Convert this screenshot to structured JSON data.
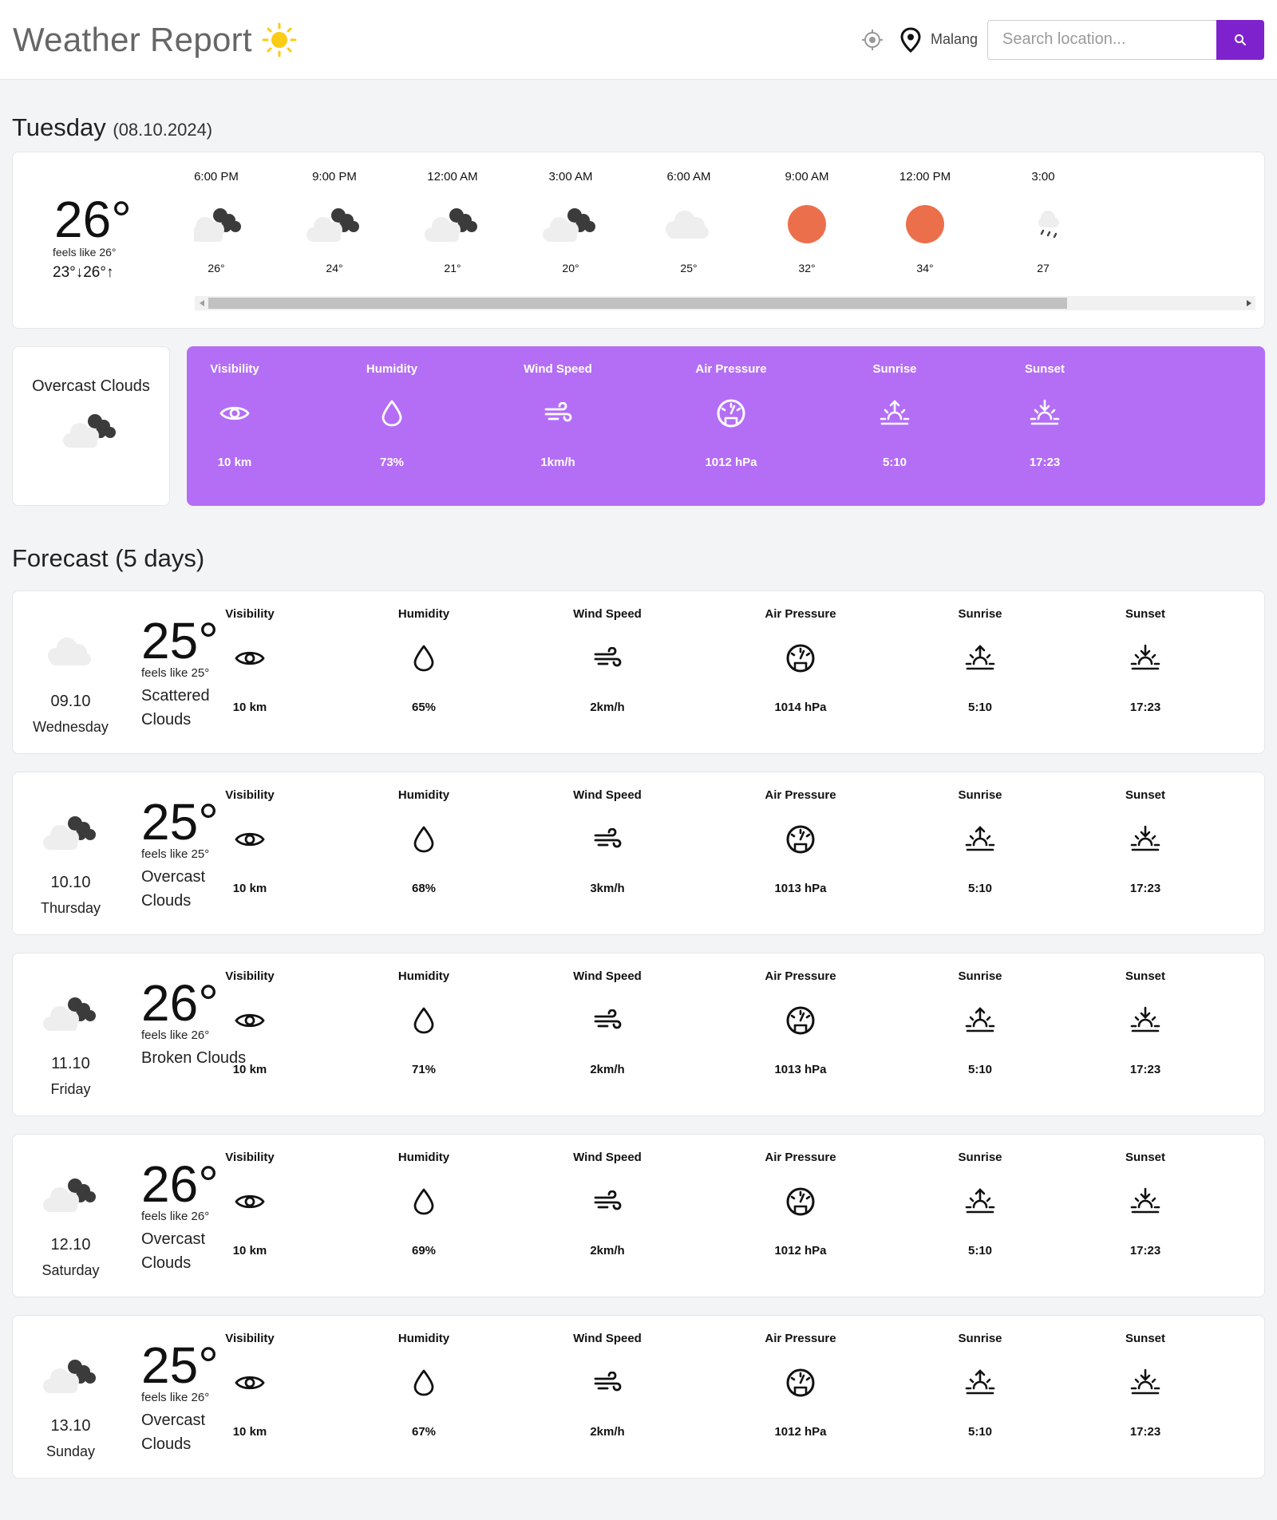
{
  "header": {
    "title": "Weather Report",
    "city": "Malang",
    "search_placeholder": "Search location..."
  },
  "today": {
    "day": "Tuesday",
    "date": "(08.10.2024)",
    "temp": "26°",
    "feels_like": "feels like 26°",
    "range": "23°↓26°↑",
    "hourly": [
      {
        "time": "6:00 PM",
        "icon": "overcast-cloud-icon",
        "temp": "26°"
      },
      {
        "time": "9:00 PM",
        "icon": "overcast-cloud-icon",
        "temp": "24°"
      },
      {
        "time": "12:00 AM",
        "icon": "overcast-cloud-icon",
        "temp": "21°"
      },
      {
        "time": "3:00 AM",
        "icon": "overcast-cloud-icon",
        "temp": "20°"
      },
      {
        "time": "6:00 AM",
        "icon": "cloud-icon",
        "temp": "25°"
      },
      {
        "time": "9:00 AM",
        "icon": "sun-icon",
        "temp": "32°"
      },
      {
        "time": "12:00 PM",
        "icon": "sun-icon",
        "temp": "34°"
      },
      {
        "time": "3:00",
        "icon": "rain-icon",
        "temp": "27"
      }
    ],
    "condition": "Overcast Clouds",
    "stats": [
      {
        "label": "Visibility",
        "icon": "eye-icon",
        "value": "10 km"
      },
      {
        "label": "Humidity",
        "icon": "droplet-icon",
        "value": "73%"
      },
      {
        "label": "Wind Speed",
        "icon": "wind-icon",
        "value": "1km/h"
      },
      {
        "label": "Air Pressure",
        "icon": "gauge-icon",
        "value": "1012 hPa"
      },
      {
        "label": "Sunrise",
        "icon": "sunrise-icon",
        "value": "5:10"
      },
      {
        "label": "Sunset",
        "icon": "sunset-icon",
        "value": "17:23"
      }
    ]
  },
  "forecast": {
    "heading": "Forecast (5 days)",
    "days": [
      {
        "date": "09.10",
        "dow": "Wednesday",
        "icon": "cloud-icon",
        "temp": "25°",
        "feels": "feels like 25°",
        "desc": "Scattered Clouds",
        "stats": [
          {
            "label": "Visibility",
            "value": "10 km"
          },
          {
            "label": "Humidity",
            "value": "65%"
          },
          {
            "label": "Wind Speed",
            "value": "2km/h"
          },
          {
            "label": "Air Pressure",
            "value": "1014 hPa"
          },
          {
            "label": "Sunrise",
            "value": "5:10"
          },
          {
            "label": "Sunset",
            "value": "17:23"
          }
        ]
      },
      {
        "date": "10.10",
        "dow": "Thursday",
        "icon": "overcast-cloud-icon",
        "temp": "25°",
        "feels": "feels like 25°",
        "desc": "Overcast Clouds",
        "stats": [
          {
            "label": "Visibility",
            "value": "10 km"
          },
          {
            "label": "Humidity",
            "value": "68%"
          },
          {
            "label": "Wind Speed",
            "value": "3km/h"
          },
          {
            "label": "Air Pressure",
            "value": "1013 hPa"
          },
          {
            "label": "Sunrise",
            "value": "5:10"
          },
          {
            "label": "Sunset",
            "value": "17:23"
          }
        ]
      },
      {
        "date": "11.10",
        "dow": "Friday",
        "icon": "overcast-cloud-icon",
        "temp": "26°",
        "feels": "feels like 26°",
        "desc": "Broken Clouds",
        "stats": [
          {
            "label": "Visibility",
            "value": "10 km"
          },
          {
            "label": "Humidity",
            "value": "71%"
          },
          {
            "label": "Wind Speed",
            "value": "2km/h"
          },
          {
            "label": "Air Pressure",
            "value": "1013 hPa"
          },
          {
            "label": "Sunrise",
            "value": "5:10"
          },
          {
            "label": "Sunset",
            "value": "17:23"
          }
        ]
      },
      {
        "date": "12.10",
        "dow": "Saturday",
        "icon": "overcast-cloud-icon",
        "temp": "26°",
        "feels": "feels like 26°",
        "desc": "Overcast Clouds",
        "stats": [
          {
            "label": "Visibility",
            "value": "10 km"
          },
          {
            "label": "Humidity",
            "value": "69%"
          },
          {
            "label": "Wind Speed",
            "value": "2km/h"
          },
          {
            "label": "Air Pressure",
            "value": "1012 hPa"
          },
          {
            "label": "Sunrise",
            "value": "5:10"
          },
          {
            "label": "Sunset",
            "value": "17:23"
          }
        ]
      },
      {
        "date": "13.10",
        "dow": "Sunday",
        "icon": "overcast-cloud-icon",
        "temp": "25°",
        "feels": "feels like 26°",
        "desc": "Overcast Clouds",
        "stats": [
          {
            "label": "Visibility",
            "value": "10 km"
          },
          {
            "label": "Humidity",
            "value": "67%"
          },
          {
            "label": "Wind Speed",
            "value": "2km/h"
          },
          {
            "label": "Air Pressure",
            "value": "1012 hPa"
          },
          {
            "label": "Sunrise",
            "value": "5:10"
          },
          {
            "label": "Sunset",
            "value": "17:23"
          }
        ]
      }
    ]
  },
  "colors": {
    "accent": "#7e22ce",
    "stats_panel": "#b46ef5",
    "sun": "#ec6f4b",
    "logo_sun": "#facc15"
  }
}
